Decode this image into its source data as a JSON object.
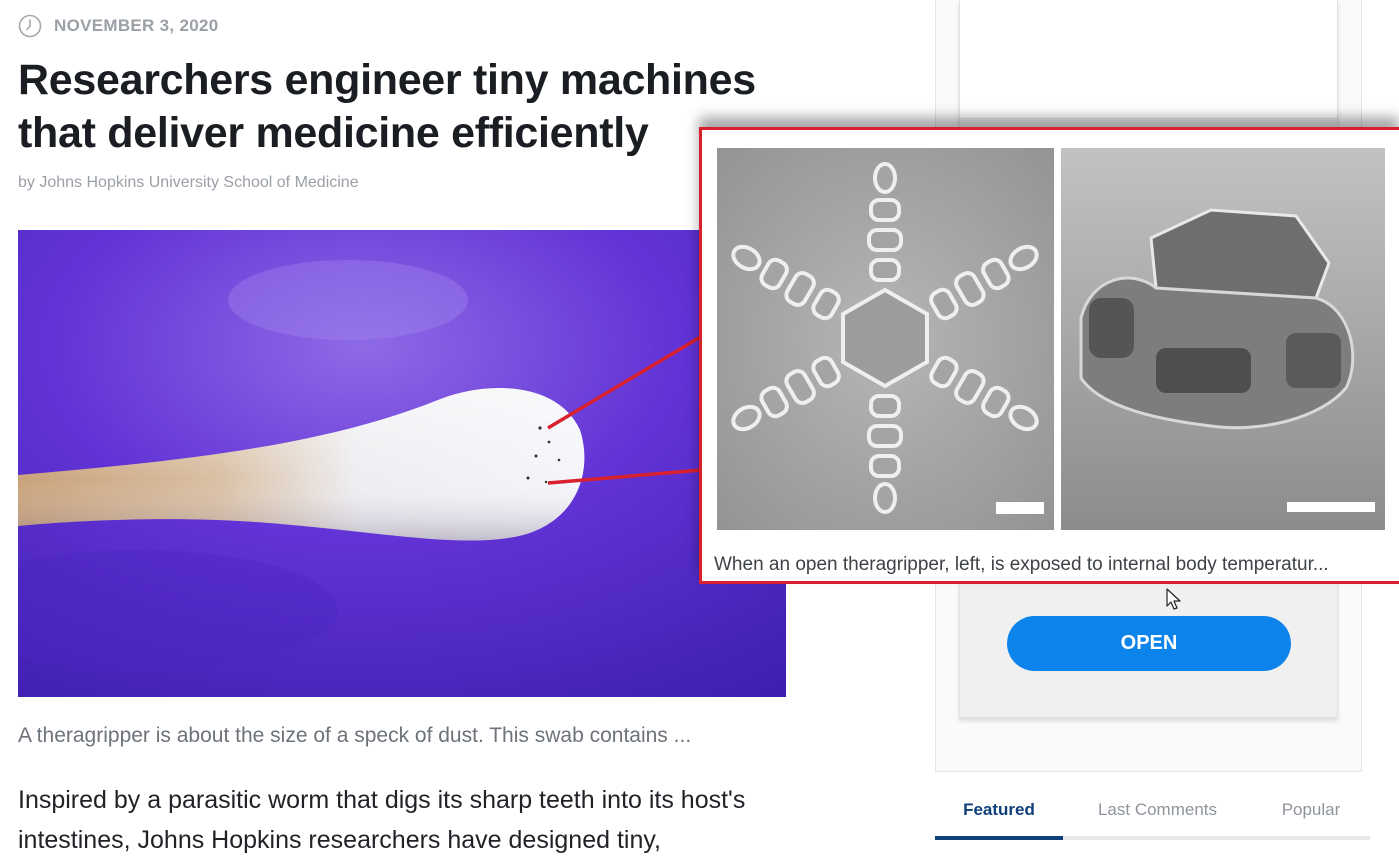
{
  "article": {
    "date": "NOVEMBER 3, 2020",
    "title": "Researchers engineer tiny machines that deliver medicine efficiently",
    "byline": "by Johns Hopkins University School of Medicine",
    "image_caption": "A theragripper is about the size of a speck of dust. This swab contains ...",
    "body": "Inspired by a parasitic worm that digs its sharp teeth into its host's intestines, Johns Hopkins researchers have designed tiny,"
  },
  "popup": {
    "caption": "When an open theragripper, left, is exposed to internal body temperatur...",
    "border_color": "#d8202e"
  },
  "sidebar": {
    "open_button_label": "OPEN",
    "tabs": [
      {
        "label": "Featured",
        "active": true
      },
      {
        "label": "Last Comments",
        "active": false
      },
      {
        "label": "Popular",
        "active": false
      }
    ]
  },
  "colors": {
    "accent": "#0d84ec",
    "tab_active": "#0f3f78",
    "photo_background": "#5a2ed0"
  },
  "icons": {
    "date_icon": "clock-icon",
    "pointer": "mouse-cursor-icon"
  }
}
